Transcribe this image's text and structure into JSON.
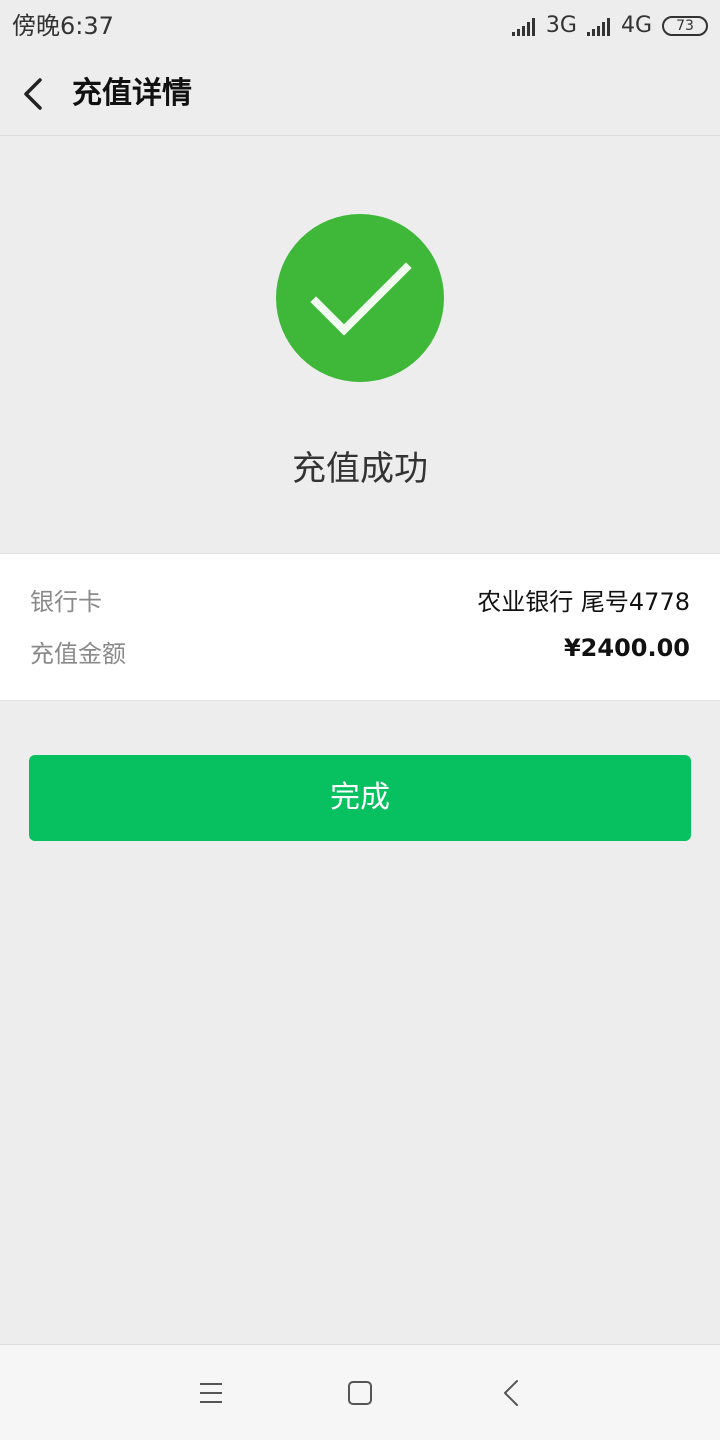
{
  "status_bar": {
    "time": "傍晚6:37",
    "network_1": "3G",
    "network_2": "4G",
    "battery": "73",
    "icons": [
      "signal-icon",
      "signal-icon",
      "battery-icon"
    ]
  },
  "header": {
    "title": "充值详情",
    "back_icon": "chevron-left-icon"
  },
  "result": {
    "icon": "check-circle-icon",
    "message": "充值成功",
    "accent_color": "#3fb83a"
  },
  "details": [
    {
      "label": "银行卡",
      "value": "农业银行 尾号4778"
    },
    {
      "label": "充值金额",
      "value": "¥2400.00"
    }
  ],
  "actions": {
    "done_label": "完成",
    "button_color": "#07c160"
  },
  "nav_bar": {
    "icons": [
      "menu-icon",
      "home-icon",
      "back-icon"
    ]
  }
}
